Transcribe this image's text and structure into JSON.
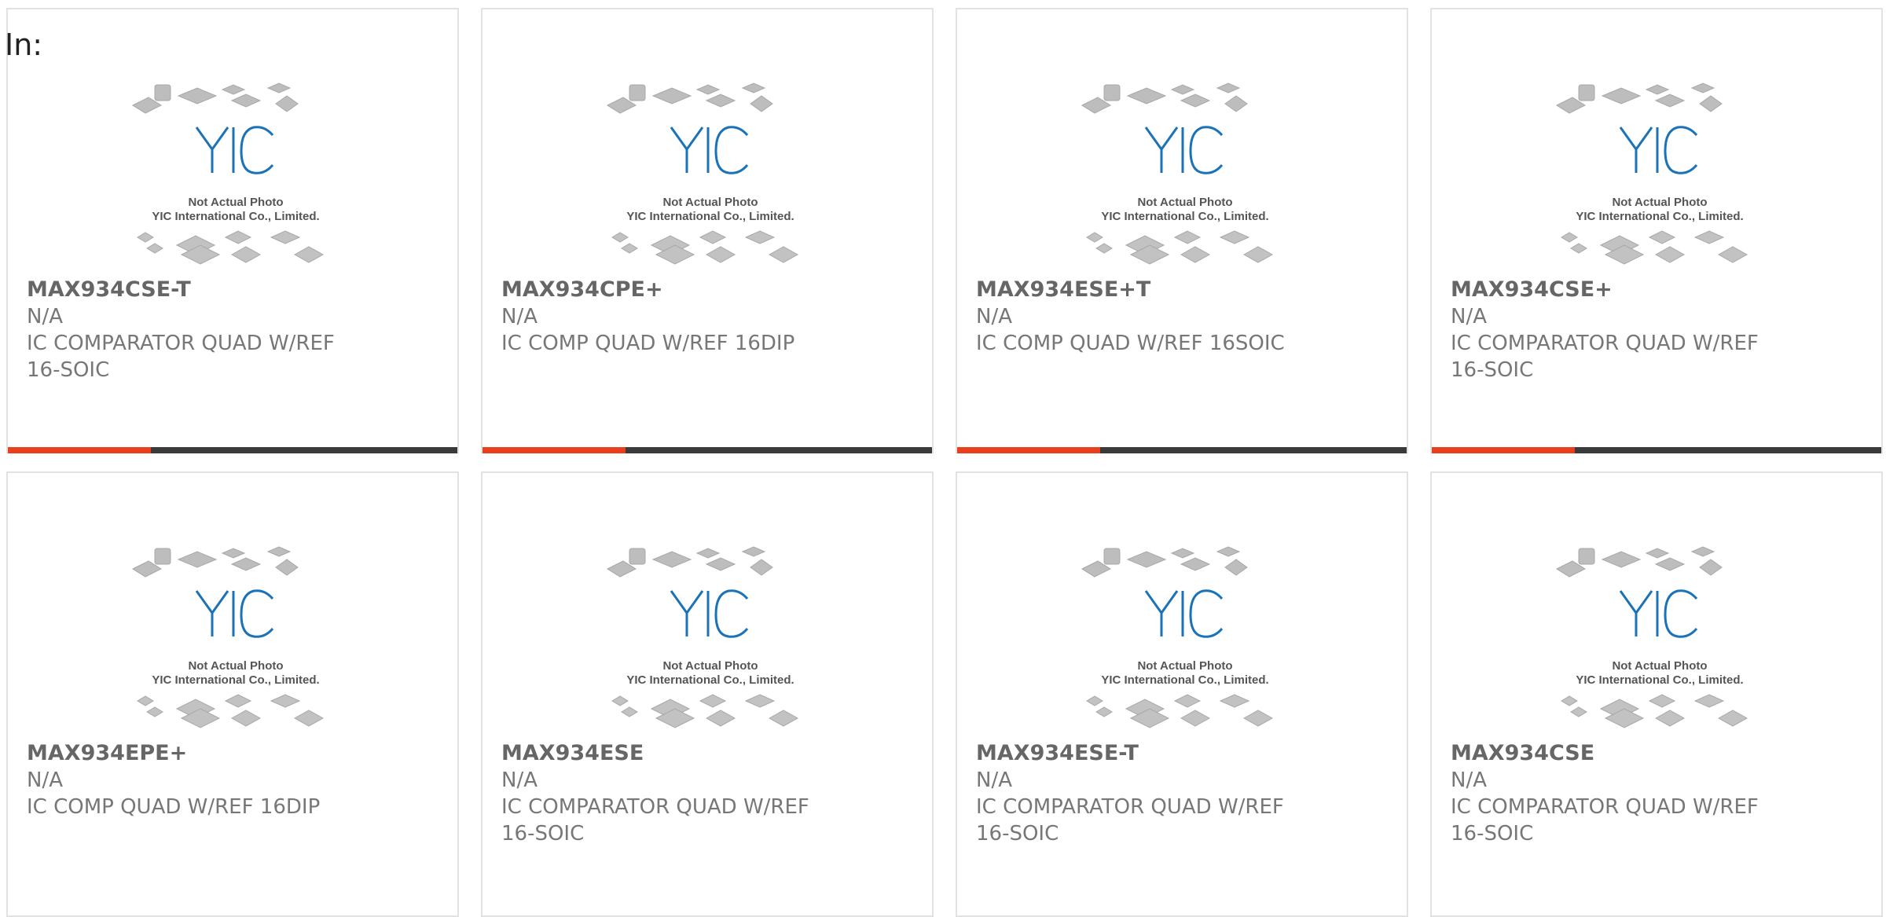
{
  "heading": {
    "label": "In:"
  },
  "photo": {
    "logo_text": "YIC",
    "caption_line1": "Not Actual Photo",
    "caption_line2": "YIC International Co., Limited."
  },
  "colors": {
    "accent": "#e8401c",
    "bar": "#3a3a3a",
    "logo_blue": "#1a73b8",
    "chip_gray": "#b5b5b5"
  },
  "products": [
    {
      "part_number": "MAX934CSE-T",
      "manufacturer": "N/A",
      "description": "IC COMPARATOR QUAD W/REF 16-SOIC"
    },
    {
      "part_number": "MAX934CPE+",
      "manufacturer": "N/A",
      "description": "IC COMP QUAD W/REF 16DIP"
    },
    {
      "part_number": "MAX934ESE+T",
      "manufacturer": "N/A",
      "description": "IC COMP QUAD W/REF 16SOIC"
    },
    {
      "part_number": "MAX934CSE+",
      "manufacturer": "N/A",
      "description": "IC COMPARATOR QUAD W/REF 16-SOIC"
    },
    {
      "part_number": "MAX934EPE+",
      "manufacturer": "N/A",
      "description": "IC COMP QUAD W/REF 16DIP"
    },
    {
      "part_number": "MAX934ESE",
      "manufacturer": "N/A",
      "description": "IC COMPARATOR QUAD W/REF 16-SOIC"
    },
    {
      "part_number": "MAX934ESE-T",
      "manufacturer": "N/A",
      "description": "IC COMPARATOR QUAD W/REF 16-SOIC"
    },
    {
      "part_number": "MAX934CSE",
      "manufacturer": "N/A",
      "description": "IC COMPARATOR QUAD W/REF 16-SOIC"
    }
  ]
}
